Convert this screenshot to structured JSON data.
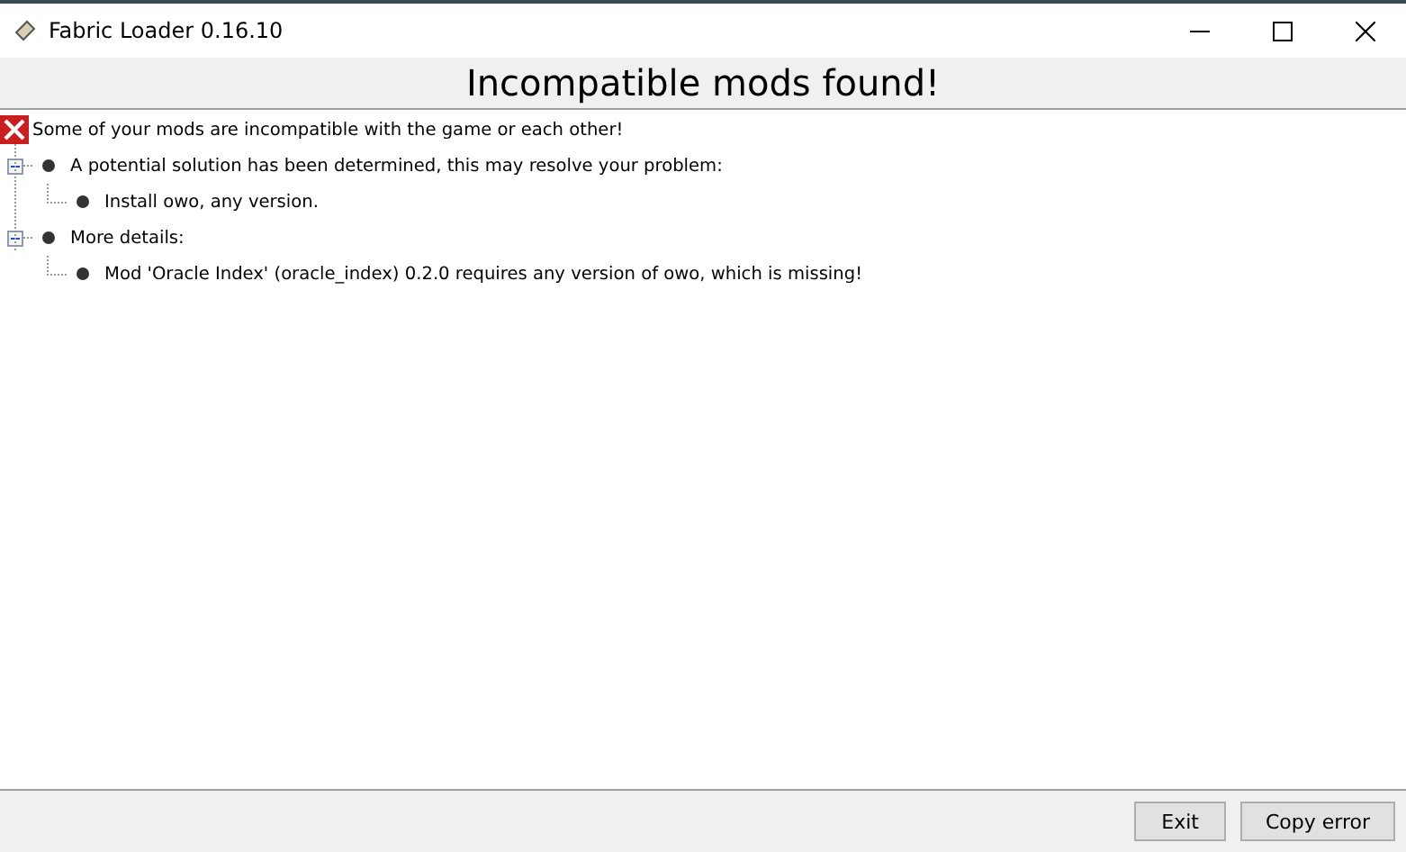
{
  "window": {
    "title": "Fabric Loader 0.16.10"
  },
  "heading": "Incompatible mods found!",
  "tree": {
    "label": "Some of your mods are incompatible with the game or each other!",
    "kind": "error",
    "children": [
      {
        "label": "A potential solution has been determined, this may resolve your problem:",
        "expanded": true,
        "children": [
          {
            "label": "Install owo, any version."
          }
        ]
      },
      {
        "label": "More details:",
        "expanded": true,
        "children": [
          {
            "label": "Mod 'Oracle Index' (oracle_index) 0.2.0 requires any version of owo, which is missing!"
          }
        ]
      }
    ]
  },
  "buttons": [
    "Exit",
    "Copy error"
  ]
}
